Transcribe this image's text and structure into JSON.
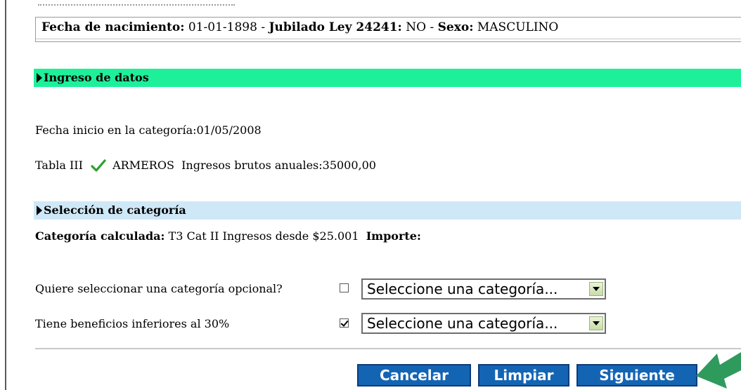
{
  "info": {
    "birth_label": "Fecha de nacimiento:",
    "birth_value": "01-01-1898",
    "sep1": "-",
    "retired_label": "Jubilado Ley 24241:",
    "retired_value": "NO",
    "sep2": "-",
    "sex_label": "Sexo:",
    "sex_value": "MASCULINO"
  },
  "data_entry": {
    "title": "Ingreso de datos",
    "start_date_label": "Fecha inicio en la categoría:",
    "start_date_value": "01/05/2008",
    "table_label": "Tabla III",
    "activity": "ARMEROS",
    "income_label": "Ingresos brutos anuales:",
    "income_value": "35000,00"
  },
  "category": {
    "title": "Selección de categoría",
    "calculated_label": "Categoría calculada:",
    "calculated_value": "T3 Cat II Ingresos desde $25.001",
    "amount_label": "Importe:"
  },
  "options": [
    {
      "label": "Quiere seleccionar una categoría opcional?",
      "checked": false,
      "select_value": "Seleccione una categoría..."
    },
    {
      "label": "Tiene beneficios inferiores al 30%",
      "checked": true,
      "select_value": "Seleccione una categoría..."
    }
  ],
  "buttons": {
    "cancel": "Cancelar",
    "clear": "Limpiar",
    "next": "Siguiente"
  },
  "colors": {
    "section_green": "#1ef09a",
    "section_blue": "#cfe8f8",
    "button_blue": "#1464b4",
    "pointer_green": "#2e9a5c",
    "checkmark_green": "#2ca02c"
  }
}
